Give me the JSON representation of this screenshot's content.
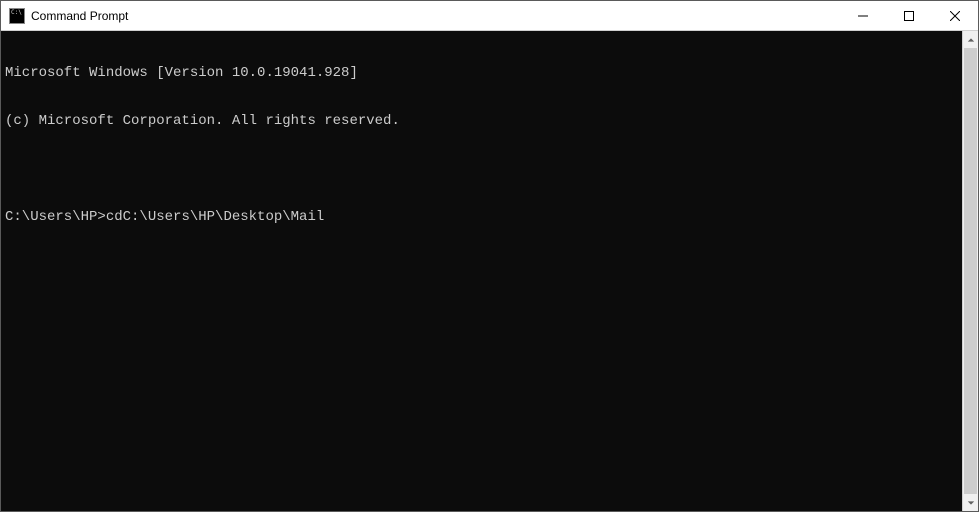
{
  "window": {
    "title": "Command Prompt"
  },
  "terminal": {
    "line1": "Microsoft Windows [Version 10.0.19041.928]",
    "line2": "(c) Microsoft Corporation. All rights reserved.",
    "blank": "",
    "prompt": "C:\\Users\\HP>",
    "command": "cdC:\\Users\\HP\\Desktop\\Mail"
  }
}
